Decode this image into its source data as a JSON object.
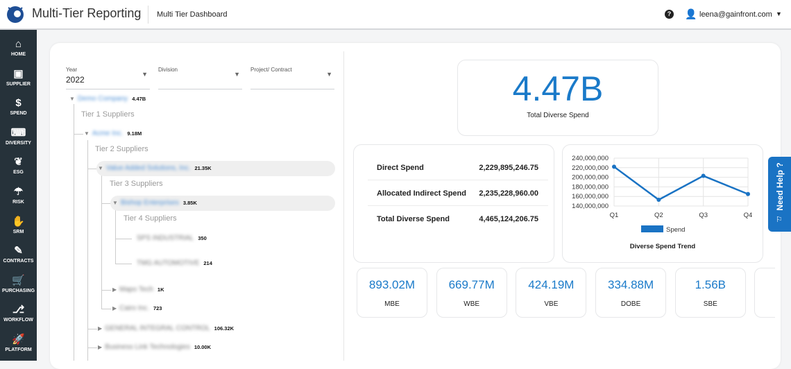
{
  "header": {
    "app_title": "Multi-Tier Reporting",
    "page_title": "Multi Tier Dashboard",
    "user_email": "leena@gainfront.com"
  },
  "sidebar": {
    "items": [
      {
        "label": "HOME",
        "icon": "⌂"
      },
      {
        "label": "SUPPLIER",
        "icon": "▣"
      },
      {
        "label": "SPEND",
        "icon": "$"
      },
      {
        "label": "DIVERSITY",
        "icon": "⌨"
      },
      {
        "label": "ESG",
        "icon": "❦"
      },
      {
        "label": "RISK",
        "icon": "☂"
      },
      {
        "label": "SRM",
        "icon": "✋"
      },
      {
        "label": "CONTRACTS",
        "icon": "✎"
      },
      {
        "label": "PURCHASING",
        "icon": "🛒"
      },
      {
        "label": "WORKFLOW",
        "icon": "⎇"
      },
      {
        "label": "PLATFORM",
        "icon": "🚀"
      }
    ]
  },
  "filters": {
    "year": {
      "label": "Year",
      "value": "2022"
    },
    "division": {
      "label": "Division",
      "value": ""
    },
    "project": {
      "label": "Project/ Contract",
      "value": ""
    }
  },
  "tree": {
    "tiers": [
      "Tier 1 Suppliers",
      "Tier 2 Suppliers",
      "Tier 3 Suppliers",
      "Tier 4 Suppliers"
    ],
    "nodes": [
      {
        "name": "Demo Company",
        "value": "4.47B"
      },
      {
        "name": "Acme Inc.",
        "value": "9.18M"
      },
      {
        "name": "Value Added Solutions, Inc.",
        "value": "21.35K"
      },
      {
        "name": "Bishop Enterprises",
        "value": "3.85K"
      },
      {
        "name": "SPS INDUSTRIAL",
        "value": "350"
      },
      {
        "name": "TMG AUTOMOTIVE",
        "value": "214"
      },
      {
        "name": "Mapo Tech",
        "value": "1K"
      },
      {
        "name": "Cairo Inc.",
        "value": "723"
      },
      {
        "name": "GENERAL INTEGRAL CONTROL",
        "value": "106.32K"
      },
      {
        "name": "Business Link Technologies",
        "value": "10.00K"
      }
    ]
  },
  "total": {
    "value": "4.47B",
    "label": "Total Diverse Spend"
  },
  "spend_table": [
    {
      "label": "Direct Spend",
      "value": "2,229,895,246.75"
    },
    {
      "label": "Allocated Indirect Spend",
      "value": "2,235,228,960.00"
    },
    {
      "label": "Total Diverse Spend",
      "value": "4,465,124,206.75"
    }
  ],
  "chart_data": {
    "type": "line",
    "title": "Diverse Spend Trend",
    "categories": [
      "Q1",
      "Q2",
      "Q3",
      "Q4"
    ],
    "series": [
      {
        "name": "Spend",
        "values": [
          222000000,
          153000000,
          203000000,
          165000000
        ],
        "color": "#1a73c4"
      }
    ],
    "ylim": [
      140000000,
      240000000
    ],
    "yticks": [
      "240,000,000",
      "220,000,000",
      "200,000,000",
      "180,000,000",
      "160,000,000",
      "140,000,000"
    ],
    "grid": true,
    "legend": "bottom"
  },
  "categories": [
    {
      "value": "893.02M",
      "label": "MBE"
    },
    {
      "value": "669.77M",
      "label": "WBE"
    },
    {
      "value": "424.19M",
      "label": "VBE"
    },
    {
      "value": "334.88M",
      "label": "DOBE"
    },
    {
      "value": "1.56B",
      "label": "SBE"
    }
  ],
  "help": {
    "label": "Need Help ?"
  },
  "colors": {
    "accent": "#1a7ac9",
    "sidebar": "#26323a"
  }
}
